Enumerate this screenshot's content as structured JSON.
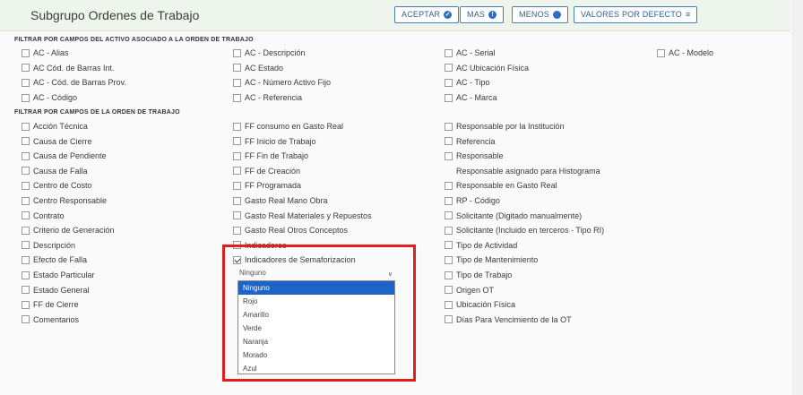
{
  "header": {
    "title": "Subgrupo Ordenes de Trabajo",
    "buttons": {
      "accept": "ACEPTAR",
      "more": "MAS",
      "less": "MENOS",
      "defaults": "VALORES POR DEFECTO"
    }
  },
  "section1": {
    "title": "FILTRAR POR CAMPOS DEL ACTIVO ASOCIADO A LA ORDEN DE TRABAJO",
    "items": [
      "AC - Alias",
      "AC - Descripción",
      "AC - Serial",
      "AC - Modelo",
      "AC   Cód. de Barras Int.",
      "AC   Estado",
      "AC   Ubicación Física",
      "AC - Cód. de Barras Prov.",
      "AC - Número Activo Fijo",
      "AC - Tipo",
      "AC - Código",
      "AC - Referencia",
      "AC - Marca"
    ]
  },
  "section2": {
    "title": "FILTRAR POR CAMPOS DE LA ORDEN DE TRABAJO",
    "col1": [
      "Acción Técnica",
      "Causa de Cierre",
      "Causa de Pendiente",
      "Causa de Falla",
      "Centro de Costo",
      "Centro Responsable",
      "Contrato",
      "Criterio de Generación",
      "Descripción",
      "Efecto de Falla",
      "Estado Particular",
      "Estado General",
      "FF de Cierre",
      "Comentarios"
    ],
    "col2": [
      "FF consumo en Gasto Real",
      "FF Inicio de Trabajo",
      "FF Fin de Trabajo",
      "FF de Creación",
      "FF Programada",
      "Gasto Real Mano Obra",
      "Gasto Real Materiales y Repuestos",
      "Gasto Real Otros Conceptos",
      "Indicadores",
      "Indicadores de Semaforizacion"
    ],
    "col3": [
      "Responsable por la Institución",
      "Referencia",
      "Responsable",
      "Responsable asignado para Histograma",
      "Responsable en Gasto Real",
      "RP - Código",
      "Solicitante (Digitado manualmente)",
      "Solicitante (Incluido en terceros - Tipo RI)",
      "Tipo de Actividad",
      "Tipo de Mantenimiento",
      "Tipo de Trabajo",
      "Origen OT",
      "Ubicación Física",
      "Días Para Vencimiento de la OT"
    ]
  },
  "select": {
    "value": "Ninguno",
    "options": [
      "Ninguno",
      "Rojo",
      "Amarillo",
      "Verde",
      "Naranja",
      "Morado",
      "Azul"
    ]
  }
}
